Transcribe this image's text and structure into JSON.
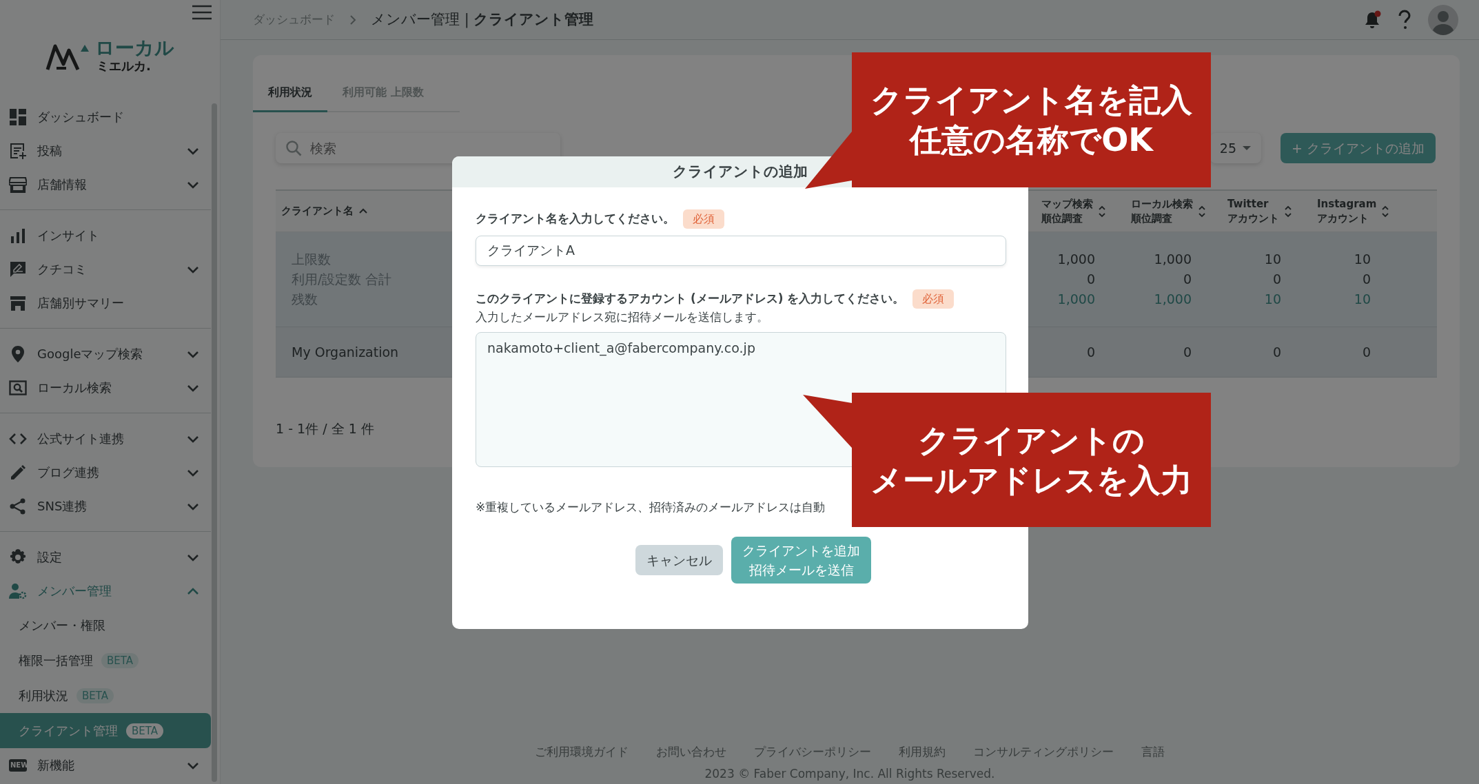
{
  "sidebar": {
    "logo": {
      "line1": "ローカル",
      "line2": "ミエルカ."
    },
    "groups": [
      [
        {
          "label": "ダッシュボード"
        },
        {
          "label": "投稿",
          "expanded": false
        },
        {
          "label": "店舗情報",
          "expanded": false
        }
      ],
      [
        {
          "label": "インサイト"
        },
        {
          "label": "クチコミ",
          "expanded": false
        },
        {
          "label": "店舗別サマリー"
        }
      ],
      [
        {
          "label": "Googleマップ検索",
          "expanded": false
        },
        {
          "label": "ローカル検索",
          "expanded": false
        }
      ],
      [
        {
          "label": "公式サイト連携",
          "expanded": false
        },
        {
          "label": "ブログ連携",
          "expanded": false
        },
        {
          "label": "SNS連携",
          "expanded": false
        }
      ],
      [
        {
          "label": "設定",
          "expanded": false
        },
        {
          "label": "メンバー管理",
          "expanded": true,
          "children": [
            {
              "label": "メンバー・権限",
              "selected": false
            },
            {
              "label": "権限一括管理",
              "badge": "BETA",
              "selected": false
            },
            {
              "label": "利用状況",
              "badge": "BETA",
              "selected": false
            },
            {
              "label": "クライアント管理",
              "badge": "BETA",
              "selected": true
            }
          ]
        },
        {
          "label": "新機能",
          "icon_label": "NEW",
          "expanded": false
        }
      ]
    ]
  },
  "header": {
    "breadcrumb": "ダッシュボード",
    "title": "メンバー管理 | **クライアント管理**",
    "notifications": {
      "unread": true
    }
  },
  "tabs": [
    {
      "label": "利用状況",
      "selected": true
    },
    {
      "label": "利用可能 上限数",
      "selected": false
    }
  ],
  "search": {
    "placeholder": "検索"
  },
  "per_page": "25",
  "add_button": "+ クライアントの追加",
  "table": {
    "columns": [
      {
        "lines": [
          "クライアント名"
        ],
        "sorted": true
      },
      {
        "lines": [
          "マップ検索",
          "順位調査"
        ],
        "sorted": false
      },
      {
        "lines": [
          "ローカル検索",
          "順位調査"
        ],
        "sorted": false
      },
      {
        "lines": [
          "Twitter",
          "アカウント"
        ],
        "sorted": false
      },
      {
        "lines": [
          "Instagram",
          "アカウント"
        ],
        "sorted": false
      }
    ],
    "rows": [
      {
        "kind": "summary",
        "cells": [
          [
            "上限数",
            "利用/設定数 合計",
            "残数"
          ],
          [
            "1,000",
            "0",
            "1,000"
          ],
          [
            "1,000",
            "0",
            "1,000"
          ],
          [
            "10",
            "0",
            "10"
          ],
          [
            "10",
            "0",
            "10"
          ]
        ]
      },
      {
        "kind": "client",
        "cells": [
          [
            "My Organization"
          ],
          [
            "0"
          ],
          [
            "0"
          ],
          [
            "0"
          ],
          [
            "0"
          ]
        ]
      }
    ]
  },
  "pagination": "1 - 1件 / 全 1 件",
  "modal": {
    "title": "クライアントの追加",
    "fields": [
      {
        "kind": "input",
        "label": "クライアント名を入力してください。",
        "required": "必須",
        "value": "クライアントA"
      },
      {
        "kind": "textarea",
        "label": "このクライアントに登録するアカウント (メールアドレス) を入力してください。",
        "required": "必須",
        "help": "入力したメールアドレス宛に招待メールを送信します。",
        "value": "nakamoto+client_a@fabercompany.co.jp"
      }
    ],
    "note": "※重複しているメールアドレス、招待済みのメールアドレスは自動",
    "buttons": [
      {
        "kind": "secondary",
        "lines": [
          "キャンセル"
        ]
      },
      {
        "kind": "primary",
        "lines": [
          "クライアントを追加",
          "招待メールを送信"
        ]
      }
    ]
  },
  "callouts": [
    {
      "lines": [
        "クライアント名を記入",
        "任意の名称でOK"
      ]
    },
    {
      "lines": [
        "クライアントの",
        "メールアドレスを入力"
      ]
    }
  ],
  "footer": {
    "links": [
      "ご利用環境ガイド",
      "お問い合わせ",
      "プライバシーポリシー",
      "利用規約",
      "コンサルティングポリシー",
      "言語"
    ],
    "copyright": "2023 © Faber Company, Inc. All Rights Reserved."
  }
}
